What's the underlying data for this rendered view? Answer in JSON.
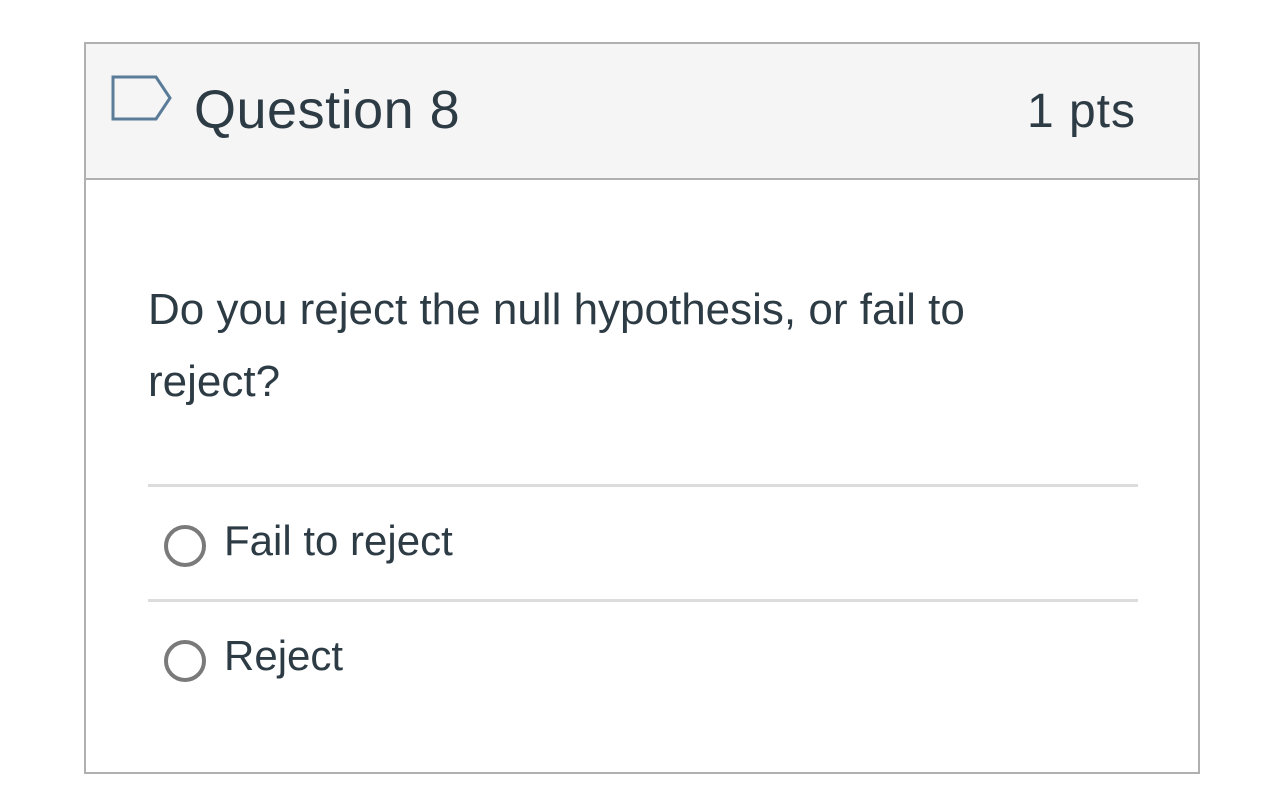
{
  "question": {
    "title": "Question 8",
    "points": "1 pts",
    "flag_icon": "flag-outline-icon",
    "text": "Do you reject the null hypothesis, or fail to reject?",
    "answers": [
      {
        "label": "Fail to reject",
        "selected": false
      },
      {
        "label": "Reject",
        "selected": false
      }
    ]
  },
  "colors": {
    "text": "#2d3b45",
    "header_bg": "#f5f5f5",
    "border": "#b0b0b0",
    "divider": "#dcdcdc",
    "radio": "#7a7a7a",
    "flag": "#5b7c99"
  }
}
